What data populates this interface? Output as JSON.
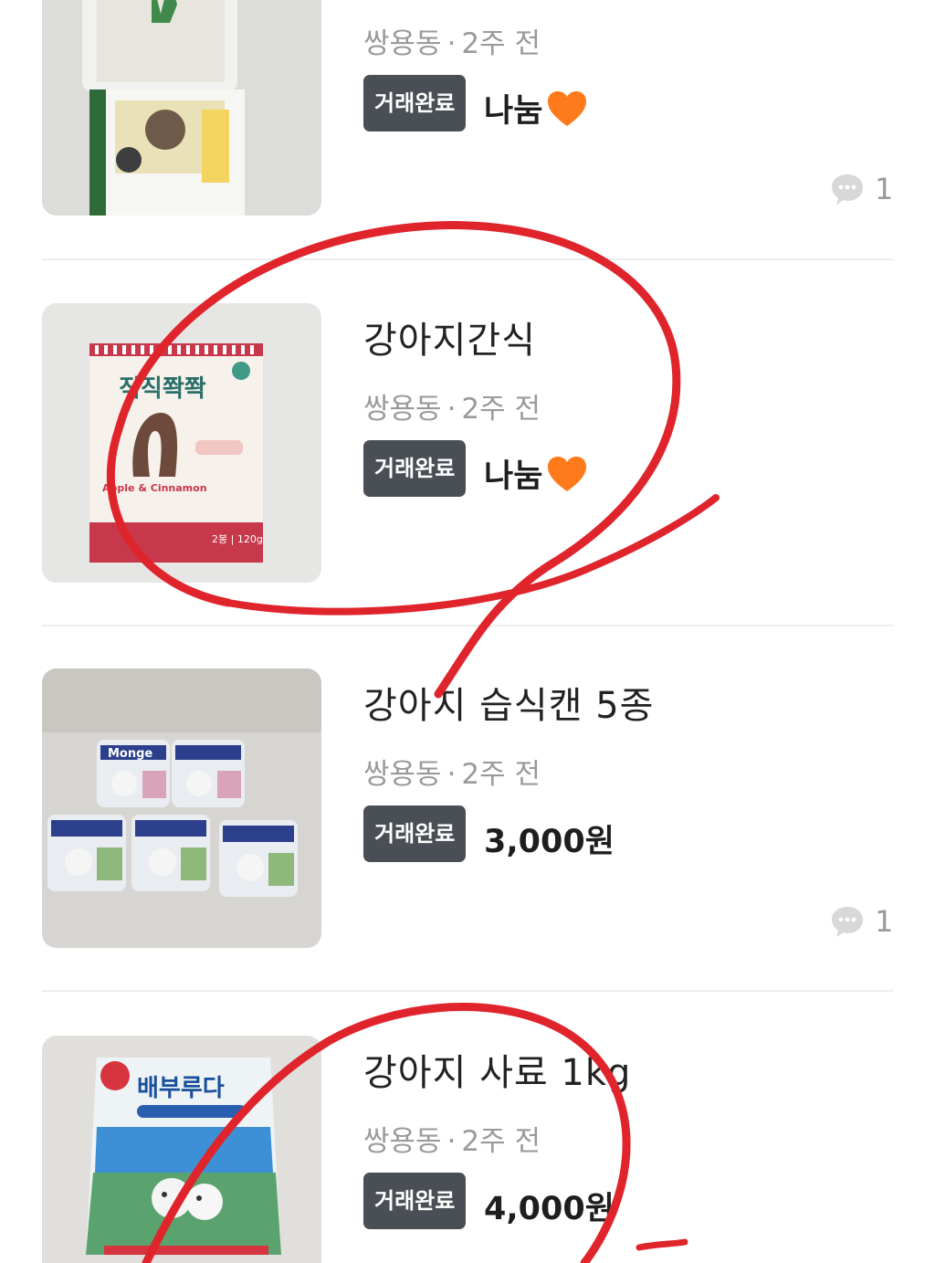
{
  "items": [
    {
      "title": "",
      "location": "쌍용동",
      "time": "2주 전",
      "status": "거래완료",
      "price": "나눔",
      "has_heart": true,
      "comments": "1"
    },
    {
      "title": "강아지간식",
      "location": "쌍용동",
      "time": "2주 전",
      "status": "거래완료",
      "price": "나눔",
      "has_heart": true,
      "comments": ""
    },
    {
      "title": "강아지 습식캔 5종",
      "location": "쌍용동",
      "time": "2주 전",
      "status": "거래완료",
      "price": "3,000원",
      "has_heart": false,
      "comments": "1"
    },
    {
      "title": "강아지 사료 1kg",
      "location": "쌍용동",
      "time": "2주 전",
      "status": "거래완료",
      "price": "4,000원",
      "has_heart": false,
      "comments": ""
    }
  ],
  "separator": "·",
  "product_labels": {
    "snack_pack_brand": "직직쫙쫙",
    "snack_pack_flavor": "Apple & Cinnamon",
    "snack_pack_weight": "2봉 | 120g",
    "can_brand": "Monge",
    "food_bag_brand": "배부루다"
  },
  "colors": {
    "badge_bg": "#4a4e55",
    "meta_text": "#9a9a9a",
    "heart": "#ff7a1a",
    "annotation_red": "#e0242c"
  },
  "icons": {
    "heart": "orange-heart-icon",
    "comment": "chat-bubble-icon"
  }
}
